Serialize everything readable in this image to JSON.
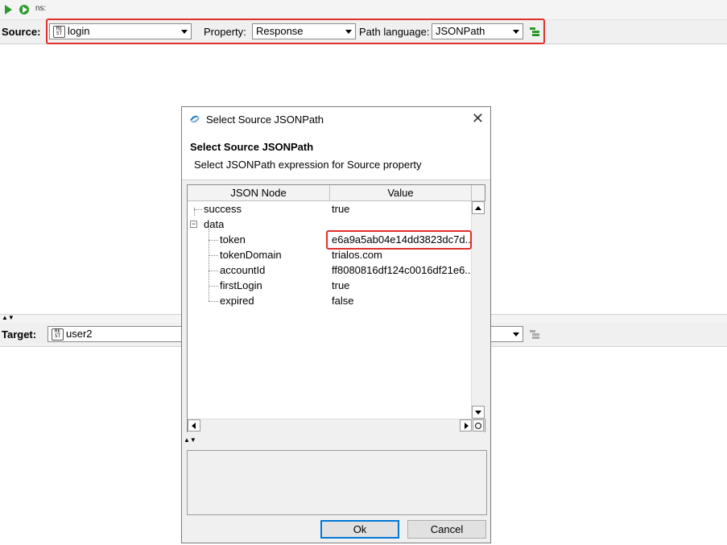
{
  "toolbar": {
    "ns_label": "ns:"
  },
  "source": {
    "label": "Source:",
    "value": "login",
    "property_label": "Property:",
    "property_value": "Response",
    "path_language_label": "Path language:",
    "path_language_value": "JSONPath",
    "rest_icon_text": "RE ST"
  },
  "target": {
    "label": "Target:",
    "value": "user2"
  },
  "dialog": {
    "title": "Select Source JSONPath",
    "close": "✕",
    "heading": "Select Source JSONPath",
    "subheading": "Select JSONPath expression for Source property",
    "columns": {
      "node": "JSON Node",
      "value": "Value"
    },
    "rows": [
      {
        "node": "success",
        "value": "true"
      },
      {
        "node": "data",
        "value": ""
      },
      {
        "node": "token",
        "value": "e6a9a5ab04e14dd3823dc7d.."
      },
      {
        "node": "tokenDomain",
        "value": "trialos.com"
      },
      {
        "node": "accountId",
        "value": "ff8080816df124c0016df21e6.."
      },
      {
        "node": "firstLogin",
        "value": "true"
      },
      {
        "node": "expired",
        "value": "false"
      }
    ],
    "ok_label": "Ok",
    "cancel_label": "Cancel"
  },
  "colors": {
    "highlight": "#e0302c",
    "play_green": "#2e9a2e"
  }
}
